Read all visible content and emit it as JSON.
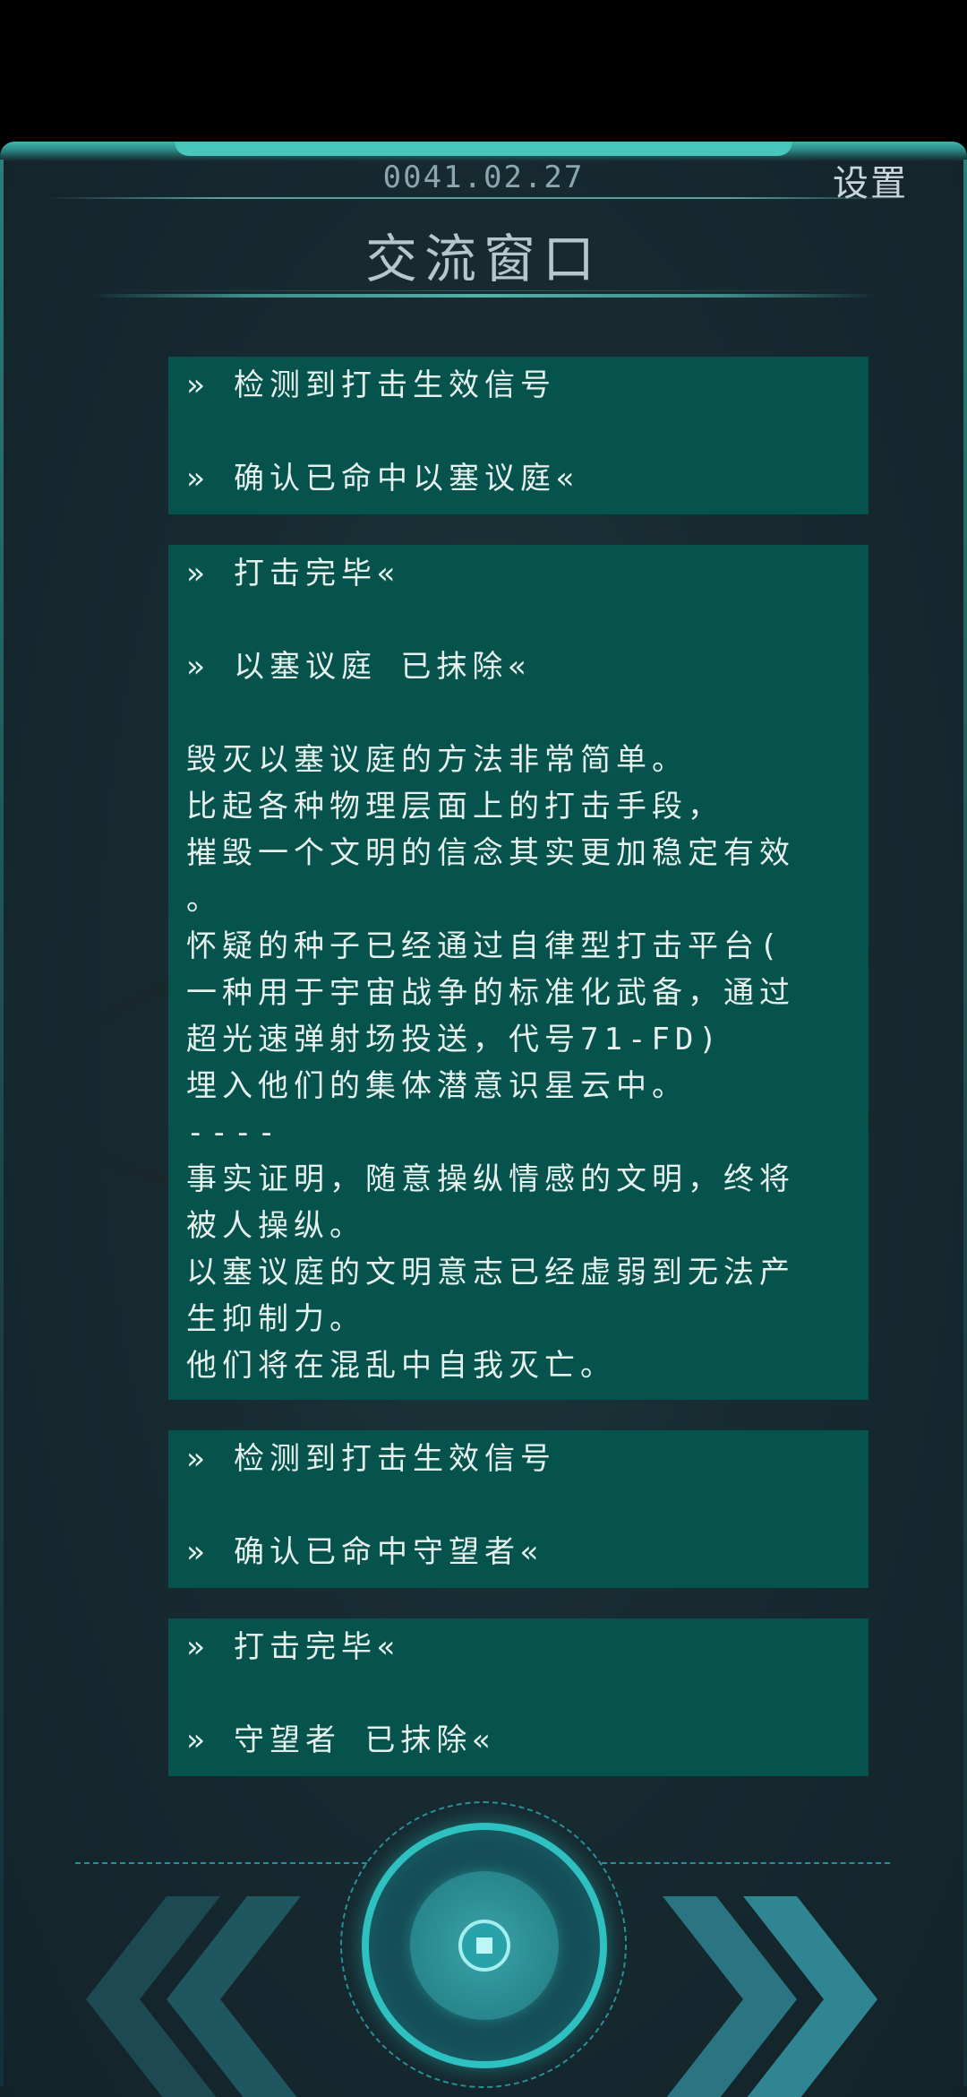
{
  "header": {
    "date": "0041.02.27",
    "settings_label": "设置",
    "title": "交流窗口"
  },
  "messages": [
    {
      "lines": [
        "» 检测到打击生效信号",
        "",
        "» 确认已命中以塞议庭«"
      ]
    },
    {
      "lines": [
        "» 打击完毕«",
        "",
        "» 以塞议庭 已抹除«",
        "",
        "毁灭以塞议庭的方法非常简单。",
        "比起各种物理层面上的打击手段，",
        "摧毁一个文明的信念其实更加稳定有效",
        "。",
        "怀疑的种子已经通过自律型打击平台(",
        "一种用于宇宙战争的标准化武备，通过",
        "超光速弹射场投送，代号71-FD)",
        "埋入他们的集体潜意识星云中。",
        "----",
        "事实证明，随意操纵情感的文明，终将",
        "被人操纵。",
        "以塞议庭的文明意志已经虚弱到无法产",
        "生抑制力。",
        "他们将在混乱中自我灭亡。"
      ]
    },
    {
      "lines": [
        "» 检测到打击生效信号",
        "",
        "» 确认已命中守望者«"
      ]
    },
    {
      "lines": [
        "» 打击完毕«",
        "",
        "» 守望者 已抹除«"
      ]
    }
  ],
  "nav": {
    "prev_icon": "double-chevron-left-icon",
    "next_icon": "double-chevron-right-icon",
    "center_icon": "radar-dial-icon"
  },
  "colors": {
    "accent": "#2fc0c0",
    "message_bg": "#06524c",
    "background": "#172b31"
  }
}
